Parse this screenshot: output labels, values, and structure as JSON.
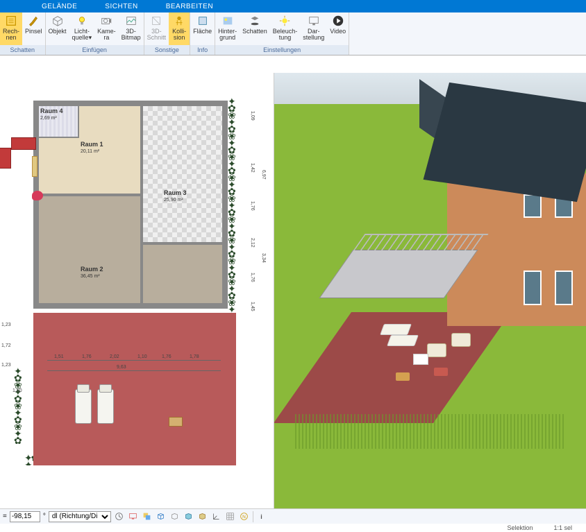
{
  "menu": {
    "gelaende": "GELÄNDE",
    "sichten": "SICHTEN",
    "bearbeiten": "BEARBEITEN"
  },
  "ribbon": {
    "schatten": {
      "label": "Schatten",
      "rechnen": "Rech-\nnen",
      "pinsel": "Pinsel"
    },
    "einfuegen": {
      "label": "Einfügen",
      "objekt": "Objekt",
      "lichtquelle": "Licht-\nquelle▾",
      "kamera": "Kame-\nra",
      "bitmap3d": "3D-\nBitmap"
    },
    "sonstige": {
      "label": "Sonstige",
      "schnitt3d": "3D-\nSchnitt",
      "kollision": "Kolli-\nsion"
    },
    "info": {
      "label": "Info",
      "flaeche": "Fläche"
    },
    "einstellungen": {
      "label": "Einstellungen",
      "hintergrund": "Hinter-\ngrund",
      "schatten": "Schatten",
      "beleuchtung": "Beleuch-\ntung",
      "darstellung": "Dar-\nstellung",
      "video": "Video"
    }
  },
  "rooms": {
    "r1": {
      "name": "Raum 1",
      "area": "20,11 m²"
    },
    "r2": {
      "name": "Raum 2",
      "area": "36,45 m²"
    },
    "r3": {
      "name": "Raum 3",
      "area": "25,90 m²"
    },
    "r4": {
      "name": "Raum 4",
      "area": "2,69 m²"
    }
  },
  "dims": {
    "top": "2,02",
    "a": "1,10",
    "b": "1,76",
    "c": "1,51",
    "d": "1,76",
    "e": "1,45",
    "f": "1,78",
    "g": "1,78",
    "right1": "1,09",
    "right2": "1,42",
    "right3": "6,97",
    "right5": "2,12",
    "right6": "3,34",
    "width": "9,63",
    "left1": "1,23",
    "left2": "1,72",
    "left3": "1,23",
    "left4": "1,60"
  },
  "bottom": {
    "value": "-98,15",
    "unit_suffix": "°",
    "dropdown": "dl (Richtung/Di"
  },
  "status": {
    "mode": "Selektion",
    "scale": "1:1 sel"
  }
}
